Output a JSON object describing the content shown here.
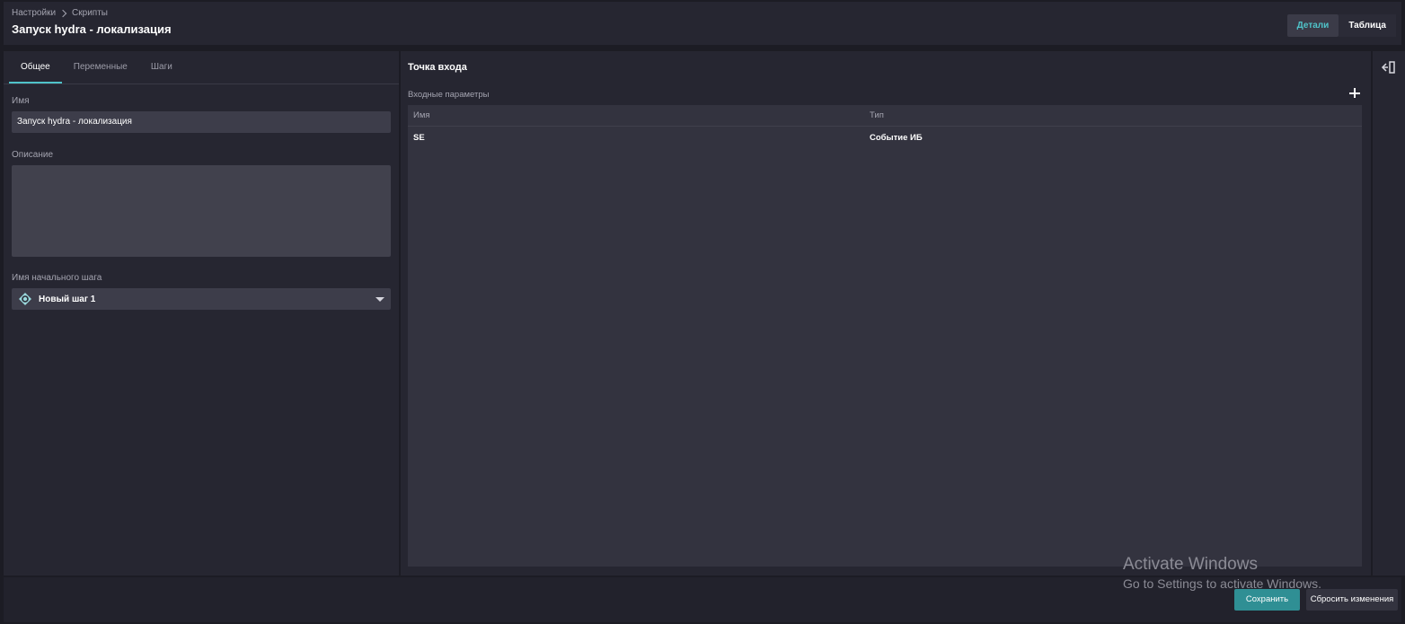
{
  "header": {
    "breadcrumb": [
      "Настройки",
      "Скрипты"
    ],
    "title": "Запуск hydra - локализация",
    "view_toggle": {
      "details_label": "Детали",
      "table_label": "Таблица",
      "active": "Детали"
    }
  },
  "left_panel": {
    "tabs": [
      {
        "label": "Общее",
        "active": true
      },
      {
        "label": "Переменные",
        "active": false
      },
      {
        "label": "Шаги",
        "active": false
      }
    ],
    "name_label": "Имя",
    "name_value": "Запуск hydra - локализация",
    "description_label": "Описание",
    "description_value": "",
    "start_step_label": "Имя начального шага",
    "start_step_value": "Новый шаг 1",
    "start_step_icon": "step-diamond-icon"
  },
  "right_panel": {
    "title": "Точка входа",
    "params_label": "Входные параметры",
    "add_icon": "plus-icon",
    "table": {
      "columns": [
        "Имя",
        "Тип"
      ],
      "rows": [
        {
          "name": "SE",
          "type": "Событие ИБ"
        }
      ]
    }
  },
  "side_rail": {
    "icon": "collapse-panel-icon"
  },
  "footer": {
    "save_label": "Сохранить",
    "reset_label": "Сбросить изменения"
  },
  "watermark": {
    "line1": "Activate Windows",
    "line2": "Go to Settings to activate Windows."
  },
  "colors": {
    "accent": "#4fc3c9",
    "save_button": "#2f8f94",
    "background": "#1c1c24",
    "panel": "#262631"
  }
}
